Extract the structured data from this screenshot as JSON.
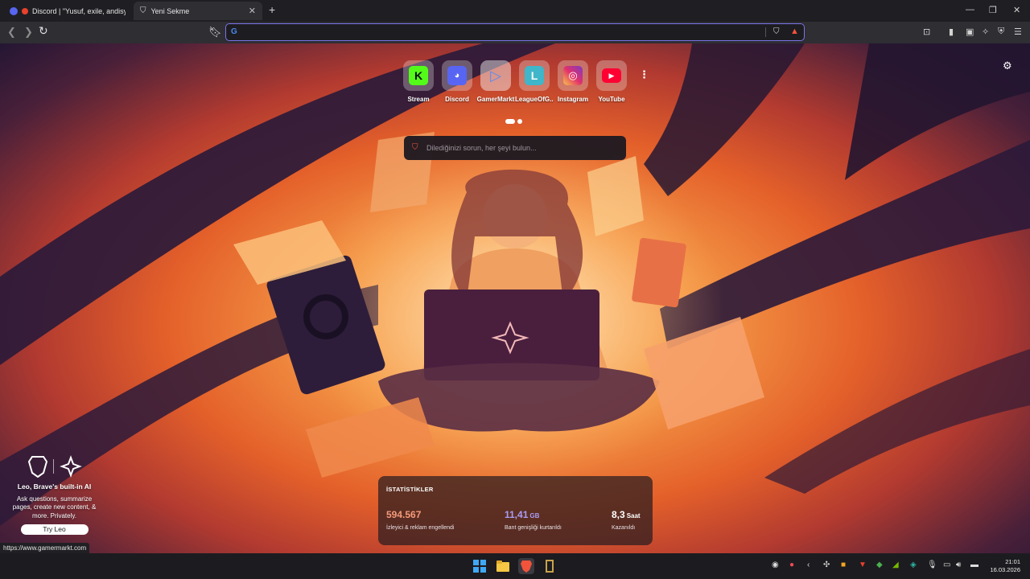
{
  "tabs": [
    {
      "title": "Discord | \"Yusuf, exile, andisya, A",
      "active": false
    },
    {
      "title": "Yeni Sekme",
      "active": true
    }
  ],
  "address_bar": {
    "value": "",
    "placeholder": ""
  },
  "top_sites": [
    {
      "label": "Stream",
      "icon": "kick-icon",
      "letter": "K",
      "color": "#53fc18"
    },
    {
      "label": "Discord",
      "icon": "discord-icon",
      "letter": "",
      "color": "#5865f2"
    },
    {
      "label": "GamerMarkt",
      "icon": "gamermarkt-icon",
      "letter": "",
      "color": "#6aa3ff"
    },
    {
      "label": "LeagueOfG...",
      "icon": "letter-l-icon",
      "letter": "L",
      "color": "#3fb6c9"
    },
    {
      "label": "Instagram",
      "icon": "instagram-icon",
      "letter": "",
      "color": "#e1306c"
    },
    {
      "label": "YouTube",
      "icon": "youtube-icon",
      "letter": "",
      "color": "#ff0033"
    }
  ],
  "search": {
    "placeholder": "Dilediğinizi sorun, her şeyi bulun..."
  },
  "leo": {
    "title": "Leo, Brave's built-in AI",
    "description": "Ask questions, summarize pages, create new content, & more. Privately.",
    "button": "Try Leo"
  },
  "status_url": "https://www.gamermarkt.com",
  "stats": {
    "header": "İSTATİSTİKLER",
    "items": [
      {
        "value": "594.567",
        "unit": "",
        "caption": "İzleyici & reklam engellendi",
        "color": "#f59a7a"
      },
      {
        "value": "11,41",
        "unit": "GB",
        "caption": "Bant genişliği kurtarıldı",
        "color": "#a99cf5"
      },
      {
        "value": "8,3",
        "unit": "Saat",
        "caption": "Kazanıldı",
        "color": "#ffffff"
      }
    ]
  },
  "clock": {
    "time": "21:01",
    "date": "16.03.2026"
  },
  "colors": {
    "accent": "#7b73e8",
    "brave": "#f1533b"
  }
}
